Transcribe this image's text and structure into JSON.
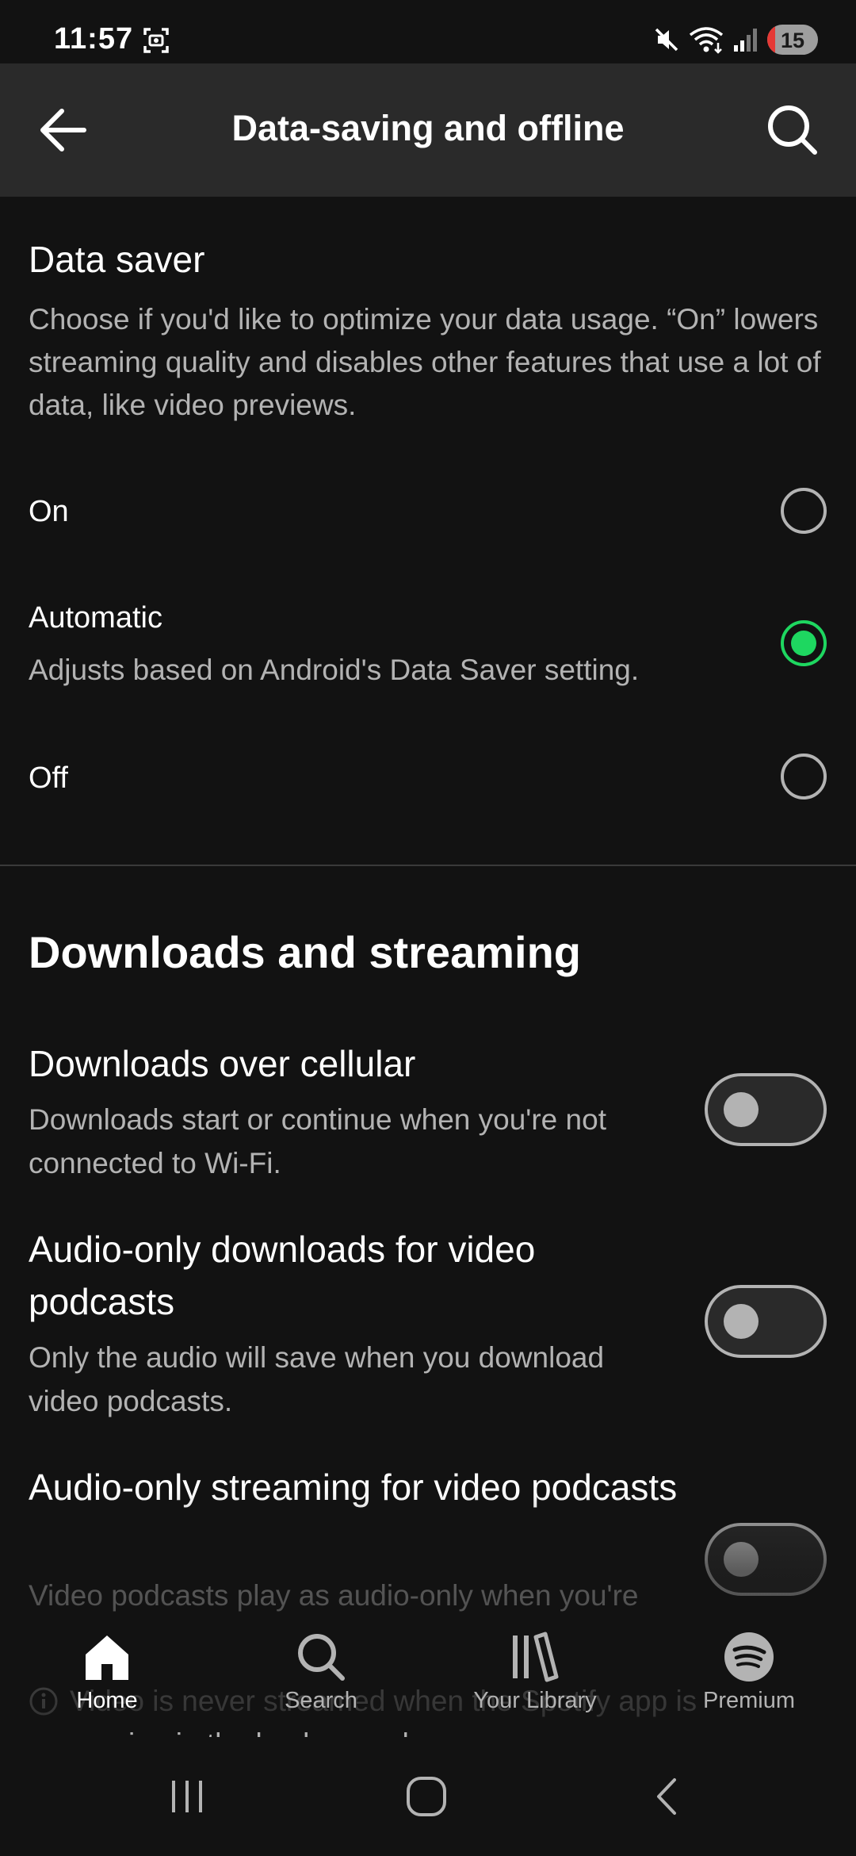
{
  "status_bar": {
    "time": "11:57",
    "battery_level": "15",
    "icons": [
      "screenshot-icon",
      "mute-icon",
      "wifi-icon",
      "signal-icon",
      "battery-icon"
    ]
  },
  "header": {
    "title": "Data-saving and offline",
    "back_icon": "back-arrow-icon",
    "search_icon": "search-icon"
  },
  "data_saver": {
    "title": "Data saver",
    "description": "Choose if you'd like to optimize your data usage. “On” lowers streaming quality and disables other features that use a lot of data, like video previews.",
    "options": [
      {
        "label": "On",
        "sublabel": "",
        "selected": false
      },
      {
        "label": "Automatic",
        "sublabel": "Adjusts based on Android's Data Saver setting.",
        "selected": true
      },
      {
        "label": "Off",
        "sublabel": "",
        "selected": false
      }
    ]
  },
  "downloads_streaming": {
    "title": "Downloads and streaming",
    "items": [
      {
        "title": "Downloads over cellular",
        "description": "Downloads start or continue when you're not connected to Wi-Fi.",
        "enabled": false
      },
      {
        "title": "Audio-only downloads for video podcasts",
        "description": "Only the audio will save when you download video podcasts.",
        "enabled": false
      },
      {
        "title": "Audio-only streaming for video podcasts",
        "description": "Video podcasts play as audio-only when you're not connected to Wi-Fi.",
        "enabled": false
      }
    ],
    "info_note": "Video is never streamed when the Spotify app is running in the background."
  },
  "bottom_nav": {
    "items": [
      {
        "label": "Home",
        "icon": "home-icon",
        "active": true
      },
      {
        "label": "Search",
        "icon": "search-icon",
        "active": false
      },
      {
        "label": "Your Library",
        "icon": "library-icon",
        "active": false
      },
      {
        "label": "Premium",
        "icon": "spotify-icon",
        "active": false
      }
    ]
  },
  "system_nav": {
    "buttons": [
      "recents-icon",
      "home-circle-icon",
      "back-chevron-icon"
    ]
  },
  "colors": {
    "background": "#121212",
    "header": "#2a2a2a",
    "accent": "#1ed760",
    "secondary_text": "#b3b3b3",
    "battery_low": "#e53935"
  }
}
